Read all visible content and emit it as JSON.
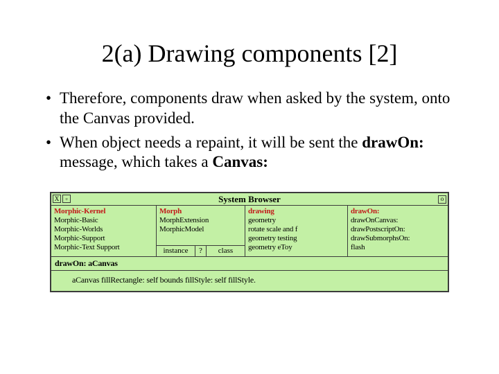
{
  "title": "2(a) Drawing components [2]",
  "bullets": [
    {
      "text": "Therefore, components draw when asked by the system, onto the Canvas provided."
    },
    {
      "prefix": "When object needs a repaint, it will be sent the ",
      "bold1": "drawOn:",
      "mid": " message, which takes a ",
      "bold2": "Canvas:"
    }
  ],
  "browser": {
    "winTitle": "System Browser",
    "closeGlyph": "X",
    "menuGlyph": "▫",
    "collapseGlyph": "o",
    "col1": [
      {
        "label": "Morphic-Kernel",
        "sel": true
      },
      {
        "label": "Morphic-Basic"
      },
      {
        "label": "Morphic-Worlds"
      },
      {
        "label": "Morphic-Support"
      },
      {
        "label": "Morphic-Text Support"
      }
    ],
    "col2": [
      {
        "label": "Morph",
        "sel": true
      },
      {
        "label": "MorphExtension"
      },
      {
        "label": "MorphicModel"
      }
    ],
    "switch": {
      "instance": "instance",
      "q": "?",
      "class": "class"
    },
    "col3": [
      {
        "label": "drawing",
        "sel": true
      },
      {
        "label": "geometry"
      },
      {
        "label": "rotate scale and f"
      },
      {
        "label": "geometry testing"
      },
      {
        "label": "geometry eToy"
      }
    ],
    "col4": [
      {
        "label": "drawOn:",
        "sel": true
      },
      {
        "label": "drawOnCanvas:"
      },
      {
        "label": "drawPostscriptOn:"
      },
      {
        "label": "drawSubmorphsOn:"
      },
      {
        "label": "flash"
      }
    ],
    "signature": "drawOn: aCanvas",
    "code": "aCanvas fillRectangle: self bounds fillStyle: self fillStyle."
  }
}
